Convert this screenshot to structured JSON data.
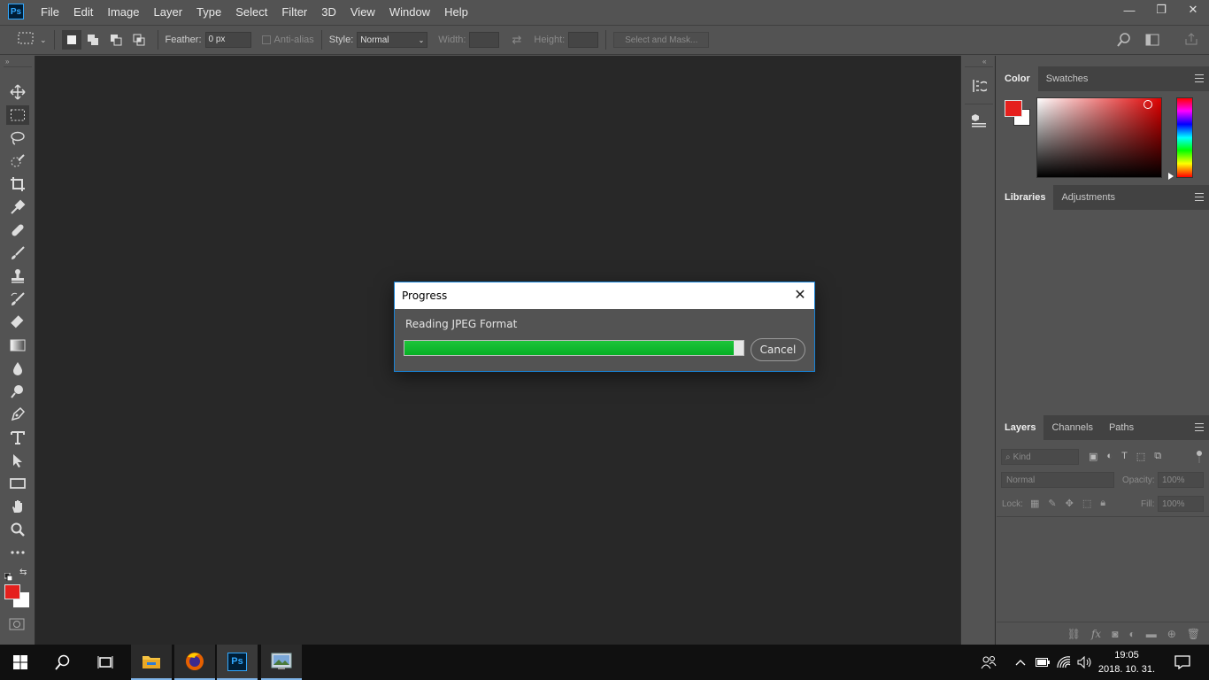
{
  "app": {
    "logo": "Ps"
  },
  "menu": [
    "File",
    "Edit",
    "Image",
    "Layer",
    "Type",
    "Select",
    "Filter",
    "3D",
    "View",
    "Window",
    "Help"
  ],
  "window_controls": {
    "minimize": "—",
    "restore": "❐",
    "close": "✕"
  },
  "options": {
    "feather_label": "Feather:",
    "feather_value": "0 px",
    "antialias_label": "Anti-alias",
    "style_label": "Style:",
    "style_value": "Normal",
    "width_label": "Width:",
    "height_label": "Height:",
    "select_mask_label": "Select and Mask..."
  },
  "tools": [
    "move-tool",
    "marquee-tool",
    "lasso-tool",
    "quick-select-tool",
    "crop-tool",
    "eyedropper-tool",
    "healing-tool",
    "brush-tool",
    "stamp-tool",
    "history-brush-tool",
    "eraser-tool",
    "gradient-tool",
    "blur-tool",
    "dodge-tool",
    "pen-tool",
    "type-tool",
    "path-select-tool",
    "rectangle-tool",
    "hand-tool",
    "zoom-tool",
    "more-tools"
  ],
  "colors": {
    "foreground": "#e5201d",
    "background": "#ffffff",
    "accent": "#1883d7",
    "progress": "#06b025"
  },
  "color_panel": {
    "tabs": [
      "Color",
      "Swatches"
    ]
  },
  "libraries_panel": {
    "tabs": [
      "Libraries",
      "Adjustments"
    ]
  },
  "layers_panel": {
    "tabs": [
      "Layers",
      "Channels",
      "Paths"
    ],
    "filter_placeholder": "Kind",
    "blend_mode": "Normal",
    "opacity_label": "Opacity:",
    "opacity_value": "100%",
    "lock_label": "Lock:",
    "fill_label": "Fill:",
    "fill_value": "100%"
  },
  "dialog": {
    "title": "Progress",
    "message": "Reading JPEG Format",
    "progress": 0.97,
    "cancel_label": "Cancel"
  },
  "taskbar": {
    "time": "19:05",
    "date": "2018. 10. 31.",
    "ps_label": "Ps"
  }
}
